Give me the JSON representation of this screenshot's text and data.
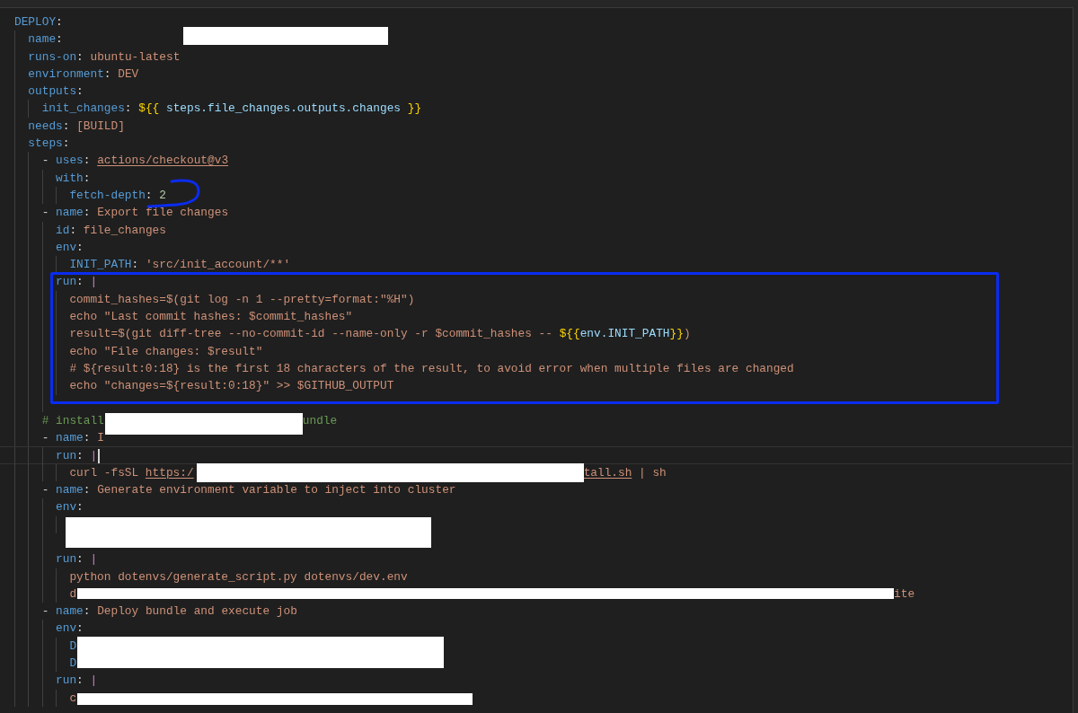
{
  "editor": {
    "lines": [
      {
        "tokens": [
          {
            "kind": "key",
            "text": "DEPLOY"
          },
          {
            "kind": "punct",
            "text": ":"
          }
        ],
        "current": false,
        "children": [
          {
            "tokens": [
              {
                "kind": "key",
                "text": "name"
              },
              {
                "kind": "punct",
                "text": ":"
              },
              {
                "kind": "redacted"
              }
            ],
            "current": false
          },
          {
            "tokens": [
              {
                "kind": "key",
                "text": "runs-on"
              },
              {
                "kind": "punct",
                "text": ":"
              },
              {
                "kind": "str",
                "text": "ubuntu-latest"
              }
            ],
            "current": false
          },
          {
            "tokens": [
              {
                "kind": "key",
                "text": "environment"
              },
              {
                "kind": "punct",
                "text": ":"
              },
              {
                "kind": "str",
                "text": "DEV"
              }
            ],
            "current": false
          },
          {
            "tokens": [
              {
                "kind": "key",
                "text": "outputs"
              },
              {
                "kind": "punct",
                "text": ":"
              }
            ],
            "current": false,
            "children": [
              {
                "tokens": [
                  {
                    "kind": "key",
                    "text": "init_changes"
                  },
                  {
                    "kind": "punct",
                    "text": ":"
                  },
                  {
                    "kind": "brace",
                    "text": "${{"
                  },
                  {
                    "kind": "var",
                    "text": "steps.file_changes.outputs.changes"
                  },
                  {
                    "kind": "brace",
                    "text": "}}"
                  }
                ],
                "current": false
              }
            ]
          },
          {
            "tokens": [
              {
                "kind": "key",
                "text": "needs"
              },
              {
                "kind": "punct",
                "text": ":"
              },
              {
                "kind": "str",
                "text": "[BUILD]"
              }
            ],
            "current": false
          },
          {
            "tokens": [
              {
                "kind": "key",
                "text": "steps"
              },
              {
                "kind": "punct",
                "text": ":"
              }
            ],
            "current": false,
            "children": [
              {
                "tokens": [
                  {
                    "kind": "dash",
                    "text": "-"
                  },
                  {
                    "kind": "key",
                    "text": "uses"
                  },
                  {
                    "kind": "punct",
                    "text": ":"
                  },
                  {
                    "kind": "link",
                    "text": "actions/checkout@v3"
                  }
                ],
                "current": false,
                "children": [
                  {
                    "tokens": [
                      {
                        "kind": "key",
                        "text": "with"
                      },
                      {
                        "kind": "punct",
                        "text": ":"
                      }
                    ],
                    "current": false,
                    "children": [
                      {
                        "tokens": [
                          {
                            "kind": "key",
                            "text": "fetch-depth"
                          },
                          {
                            "kind": "punct",
                            "text": ":"
                          },
                          {
                            "kind": "num",
                            "text": "2"
                          }
                        ],
                        "current": false
                      }
                    ]
                  }
                ]
              },
              {
                "tokens": [
                  {
                    "kind": "dash",
                    "text": "-"
                  },
                  {
                    "kind": "key",
                    "text": "name"
                  },
                  {
                    "kind": "punct",
                    "text": ":"
                  },
                  {
                    "kind": "str",
                    "text": "Export file changes"
                  }
                ],
                "current": false,
                "children": [
                  {
                    "tokens": [
                      {
                        "kind": "key",
                        "text": "id"
                      },
                      {
                        "kind": "punct",
                        "text": ":"
                      },
                      {
                        "kind": "str",
                        "text": "file_changes"
                      }
                    ],
                    "current": false
                  },
                  {
                    "tokens": [
                      {
                        "kind": "key",
                        "text": "env"
                      },
                      {
                        "kind": "punct",
                        "text": ":"
                      }
                    ],
                    "current": false,
                    "children": [
                      {
                        "tokens": [
                          {
                            "kind": "key",
                            "text": "INIT_PATH"
                          },
                          {
                            "kind": "punct",
                            "text": ":"
                          },
                          {
                            "kind": "str",
                            "text": "'src/init_account/**'"
                          }
                        ],
                        "current": false
                      }
                    ]
                  },
                  {
                    "tokens": [
                      {
                        "kind": "key",
                        "text": "run"
                      },
                      {
                        "kind": "punct",
                        "text": ":"
                      },
                      {
                        "kind": "pipe",
                        "text": "|"
                      }
                    ],
                    "current": false,
                    "children": [
                      {
                        "tokens": [
                          {
                            "kind": "str",
                            "text": "commit_hashes=$(git log -n 1 --pretty=format:\"%H\")"
                          }
                        ],
                        "current": false
                      },
                      {
                        "tokens": [
                          {
                            "kind": "str",
                            "text": "echo \"Last commit hashes: $commit_hashes\""
                          }
                        ],
                        "current": false
                      },
                      {
                        "tokens": [
                          {
                            "kind": "str",
                            "text": "result=$(git diff-tree --no-commit-id --name-only -r $commit_hashes --"
                          },
                          {
                            "kind": "brace",
                            "text": "${{"
                          },
                          {
                            "kind": "var",
                            "text": "env.INIT_PATH"
                          },
                          {
                            "kind": "brace",
                            "text": "}}"
                          },
                          {
                            "kind": "str",
                            "text": ")"
                          }
                        ],
                        "current": false
                      },
                      {
                        "tokens": [
                          {
                            "kind": "str",
                            "text": "echo \"File changes: $result\""
                          }
                        ],
                        "current": false
                      },
                      {
                        "tokens": [
                          {
                            "kind": "str",
                            "text": "# ${result:0:18} is the first 18 characters of the result, to avoid error when multiple files are changed"
                          }
                        ],
                        "current": false
                      },
                      {
                        "tokens": [
                          {
                            "kind": "str",
                            "text": "echo \"changes=${result:0:18}\" >> $GITHUB_OUTPUT"
                          }
                        ],
                        "current": false
                      }
                    ]
                  },
                  {
                    "current": false
                  }
                ]
              },
              {
                "tokens": [
                  {
                    "kind": "comment",
                    "text": "# install"
                  },
                  {
                    "kind": "redacted"
                  },
                  {
                    "kind": "comment",
                    "text": "undle"
                  }
                ],
                "current": false
              },
              {
                "tokens": [
                  {
                    "kind": "dash",
                    "text": "-"
                  },
                  {
                    "kind": "key",
                    "text": "name"
                  },
                  {
                    "kind": "punct",
                    "text": ":"
                  },
                  {
                    "kind": "str",
                    "text": "I"
                  }
                ],
                "current": false,
                "children": [
                  {
                    "tokens": [
                      {
                        "kind": "key",
                        "text": "run"
                      },
                      {
                        "kind": "punct",
                        "text": ":"
                      },
                      {
                        "kind": "pipe",
                        "text": "|"
                      }
                    ],
                    "current": true,
                    "children": [
                      {
                        "tokens": [
                          {
                            "kind": "str",
                            "text": "curl -fsSL"
                          },
                          {
                            "kind": "link",
                            "text": "https:/"
                          },
                          {
                            "kind": "redacted"
                          },
                          {
                            "kind": "link",
                            "text": "tall.sh"
                          },
                          {
                            "kind": "str",
                            "text": "| sh"
                          }
                        ],
                        "current": false
                      }
                    ]
                  }
                ]
              },
              {
                "tokens": [
                  {
                    "kind": "dash",
                    "text": "-"
                  },
                  {
                    "kind": "key",
                    "text": "name"
                  },
                  {
                    "kind": "punct",
                    "text": ":"
                  },
                  {
                    "kind": "str",
                    "text": "Generate environment variable to inject into cluster"
                  }
                ],
                "current": false,
                "children": [
                  {
                    "tokens": [
                      {
                        "kind": "key",
                        "text": "env"
                      },
                      {
                        "kind": "punct",
                        "text": ":"
                      }
                    ],
                    "current": false,
                    "children": [
                      {
                        "tokens": [
                          {
                            "kind": "redacted"
                          }
                        ],
                        "current": false
                      }
                    ]
                  },
                  {
                    "current": false
                  },
                  {
                    "tokens": [
                      {
                        "kind": "key",
                        "text": "run"
                      },
                      {
                        "kind": "punct",
                        "text": ":"
                      },
                      {
                        "kind": "pipe",
                        "text": "|"
                      }
                    ],
                    "current": false,
                    "children": [
                      {
                        "tokens": [
                          {
                            "kind": "str",
                            "text": "python dotenvs/generate_script.py dotenvs/dev.env"
                          }
                        ],
                        "current": false
                      },
                      {
                        "tokens": [
                          {
                            "kind": "str",
                            "text": "d"
                          },
                          {
                            "kind": "redacted"
                          },
                          {
                            "kind": "str",
                            "text": "ite"
                          }
                        ],
                        "current": false
                      }
                    ]
                  }
                ]
              },
              {
                "tokens": [
                  {
                    "kind": "dash",
                    "text": "-"
                  },
                  {
                    "kind": "key",
                    "text": "name"
                  },
                  {
                    "kind": "punct",
                    "text": ":"
                  },
                  {
                    "kind": "str",
                    "text": "Deploy bundle and execute job"
                  }
                ],
                "current": false,
                "children": [
                  {
                    "tokens": [
                      {
                        "kind": "key",
                        "text": "env"
                      },
                      {
                        "kind": "punct",
                        "text": ":"
                      }
                    ],
                    "current": false,
                    "children": [
                      {
                        "tokens": [
                          {
                            "kind": "key",
                            "text": "D"
                          },
                          {
                            "kind": "redacted"
                          }
                        ],
                        "current": false
                      },
                      {
                        "tokens": [
                          {
                            "kind": "key",
                            "text": "D"
                          }
                        ],
                        "current": false
                      }
                    ]
                  },
                  {
                    "tokens": [
                      {
                        "kind": "key",
                        "text": "run"
                      },
                      {
                        "kind": "punct",
                        "text": ":"
                      },
                      {
                        "kind": "pipe",
                        "text": "|"
                      }
                    ],
                    "current": false,
                    "children": [
                      {
                        "tokens": [
                          {
                            "kind": "str",
                            "text": "c"
                          },
                          {
                            "kind": "redacted"
                          }
                        ],
                        "current": false
                      }
                    ]
                  }
                ]
              }
            ]
          }
        ]
      }
    ]
  }
}
